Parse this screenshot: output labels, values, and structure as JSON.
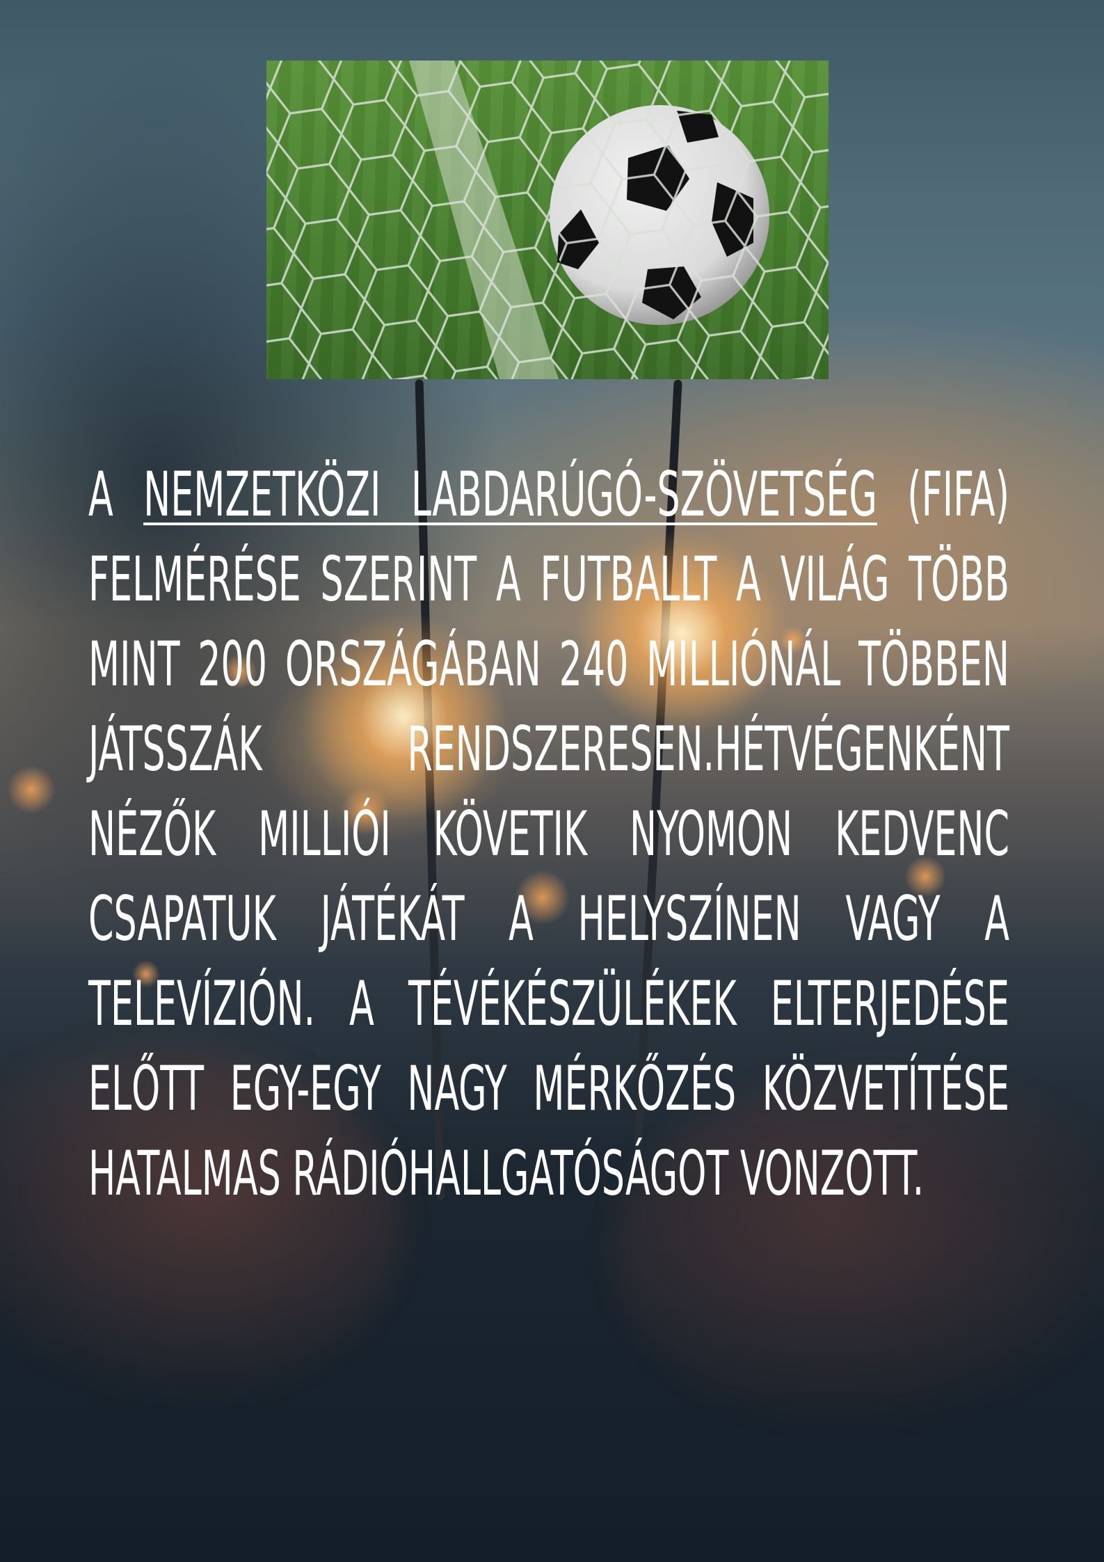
{
  "header_image": {
    "icon": "soccer-ball-in-net-photo"
  },
  "article": {
    "prefix": "A",
    "link_text": "NEMZETKÖZI LABDARÚGÓ-SZÖVETSÉG",
    "body": "(FIFA) FELMÉRÉSE SZERINT A FUTBALLT A VILÁG TÖBB MINT 200 ORSZÁGÁBAN 240 MILLIÓNÁL TÖBBEN JÁTSSZÁK RENDSZERESEN.HÉTVÉGENKÉNT NÉZŐK MILLIÓI KÖVETIK NYOMON KEDVENC CSAPATUK JÁTÉKÁT A HELYSZÍNEN VAGY A TELEVÍZIÓN. A TÉVÉKÉSZÜLÉKEK ELTERJEDÉSE ELŐTT EGY-EGY NAGY MÉRKŐZÉS KÖZVETÍTÉSE HATALMAS RÁDIÓHALLGATÓSÁGOT VONZOTT."
  },
  "colors": {
    "text": "#ffffff",
    "background_dark": "#141e28",
    "glow": "#ffb060"
  }
}
